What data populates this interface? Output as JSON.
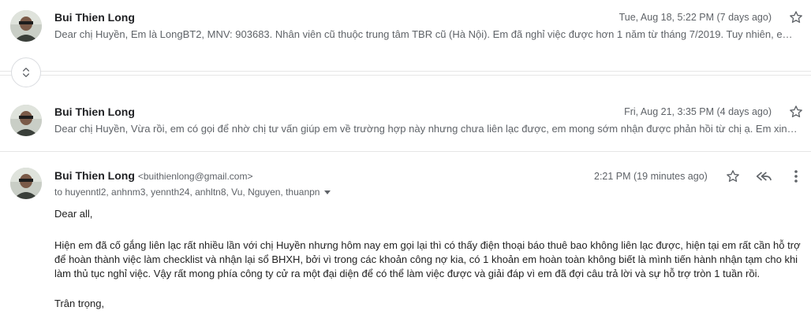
{
  "messages": [
    {
      "sender": "Bui Thien Long",
      "date": "Tue, Aug 18, 5:22 PM (7 days ago)",
      "snippet": "Dear chị Huyền, Em là LongBT2, MNV: 903683. Nhân viên cũ thuộc trung tâm TBR cũ (Hà Nội). Em đã nghỉ việc được hơn 1 năm từ tháng 7/2019. Tuy nhiên, em vẫn chưa nhận được..."
    },
    {
      "sender": "Bui Thien Long",
      "date": "Fri, Aug 21, 3:35 PM (4 days ago)",
      "snippet": "Dear chị Huyền, Vừa rồi, em có gọi để nhờ chị tư vấn giúp em về trường hợp này nhưng chưa liên lạc được, em mong sớm nhận được phản hồi từ chị ạ. Em xin cảm ơn."
    }
  ],
  "open_message": {
    "sender": "Bui Thien Long",
    "email": "<buithienlong@gmail.com>",
    "date": "2:21 PM (19 minutes ago)",
    "to": "to huyenntl2, anhnm3, yennth24, anhltn8, Vu, Nguyen, thuanpn",
    "greeting": "Dear all,",
    "paragraph_lines": [
      "Hiện em đã cố gắng liên lạc rất nhiều lần với chị Huyền nhưng hôm nay em gọi lại thì có thấy điện thoại báo thuê bao không liên lạc được, hiện tại em rất cần hỗ trợ",
      "để hoàn thành việc làm checklist và nhận lại sổ BHXH, bởi vì trong các khoản công nợ kia, có 1 khoản em hoàn toàn không biết là mình tiến hành nhận tạm cho khi",
      "làm thủ tục nghỉ việc. Vậy rất mong phía công ty cử ra một đại diện để có thể làm việc được và giải đáp vì em đã đợi câu trả lời và sự hỗ trợ tròn 1 tuần rồi."
    ],
    "closing": "Trân trọng,"
  },
  "icons": {
    "star": "star-icon",
    "reply": "reply-icon",
    "more": "more-vert-icon",
    "expand": "unfold-more-icon"
  }
}
